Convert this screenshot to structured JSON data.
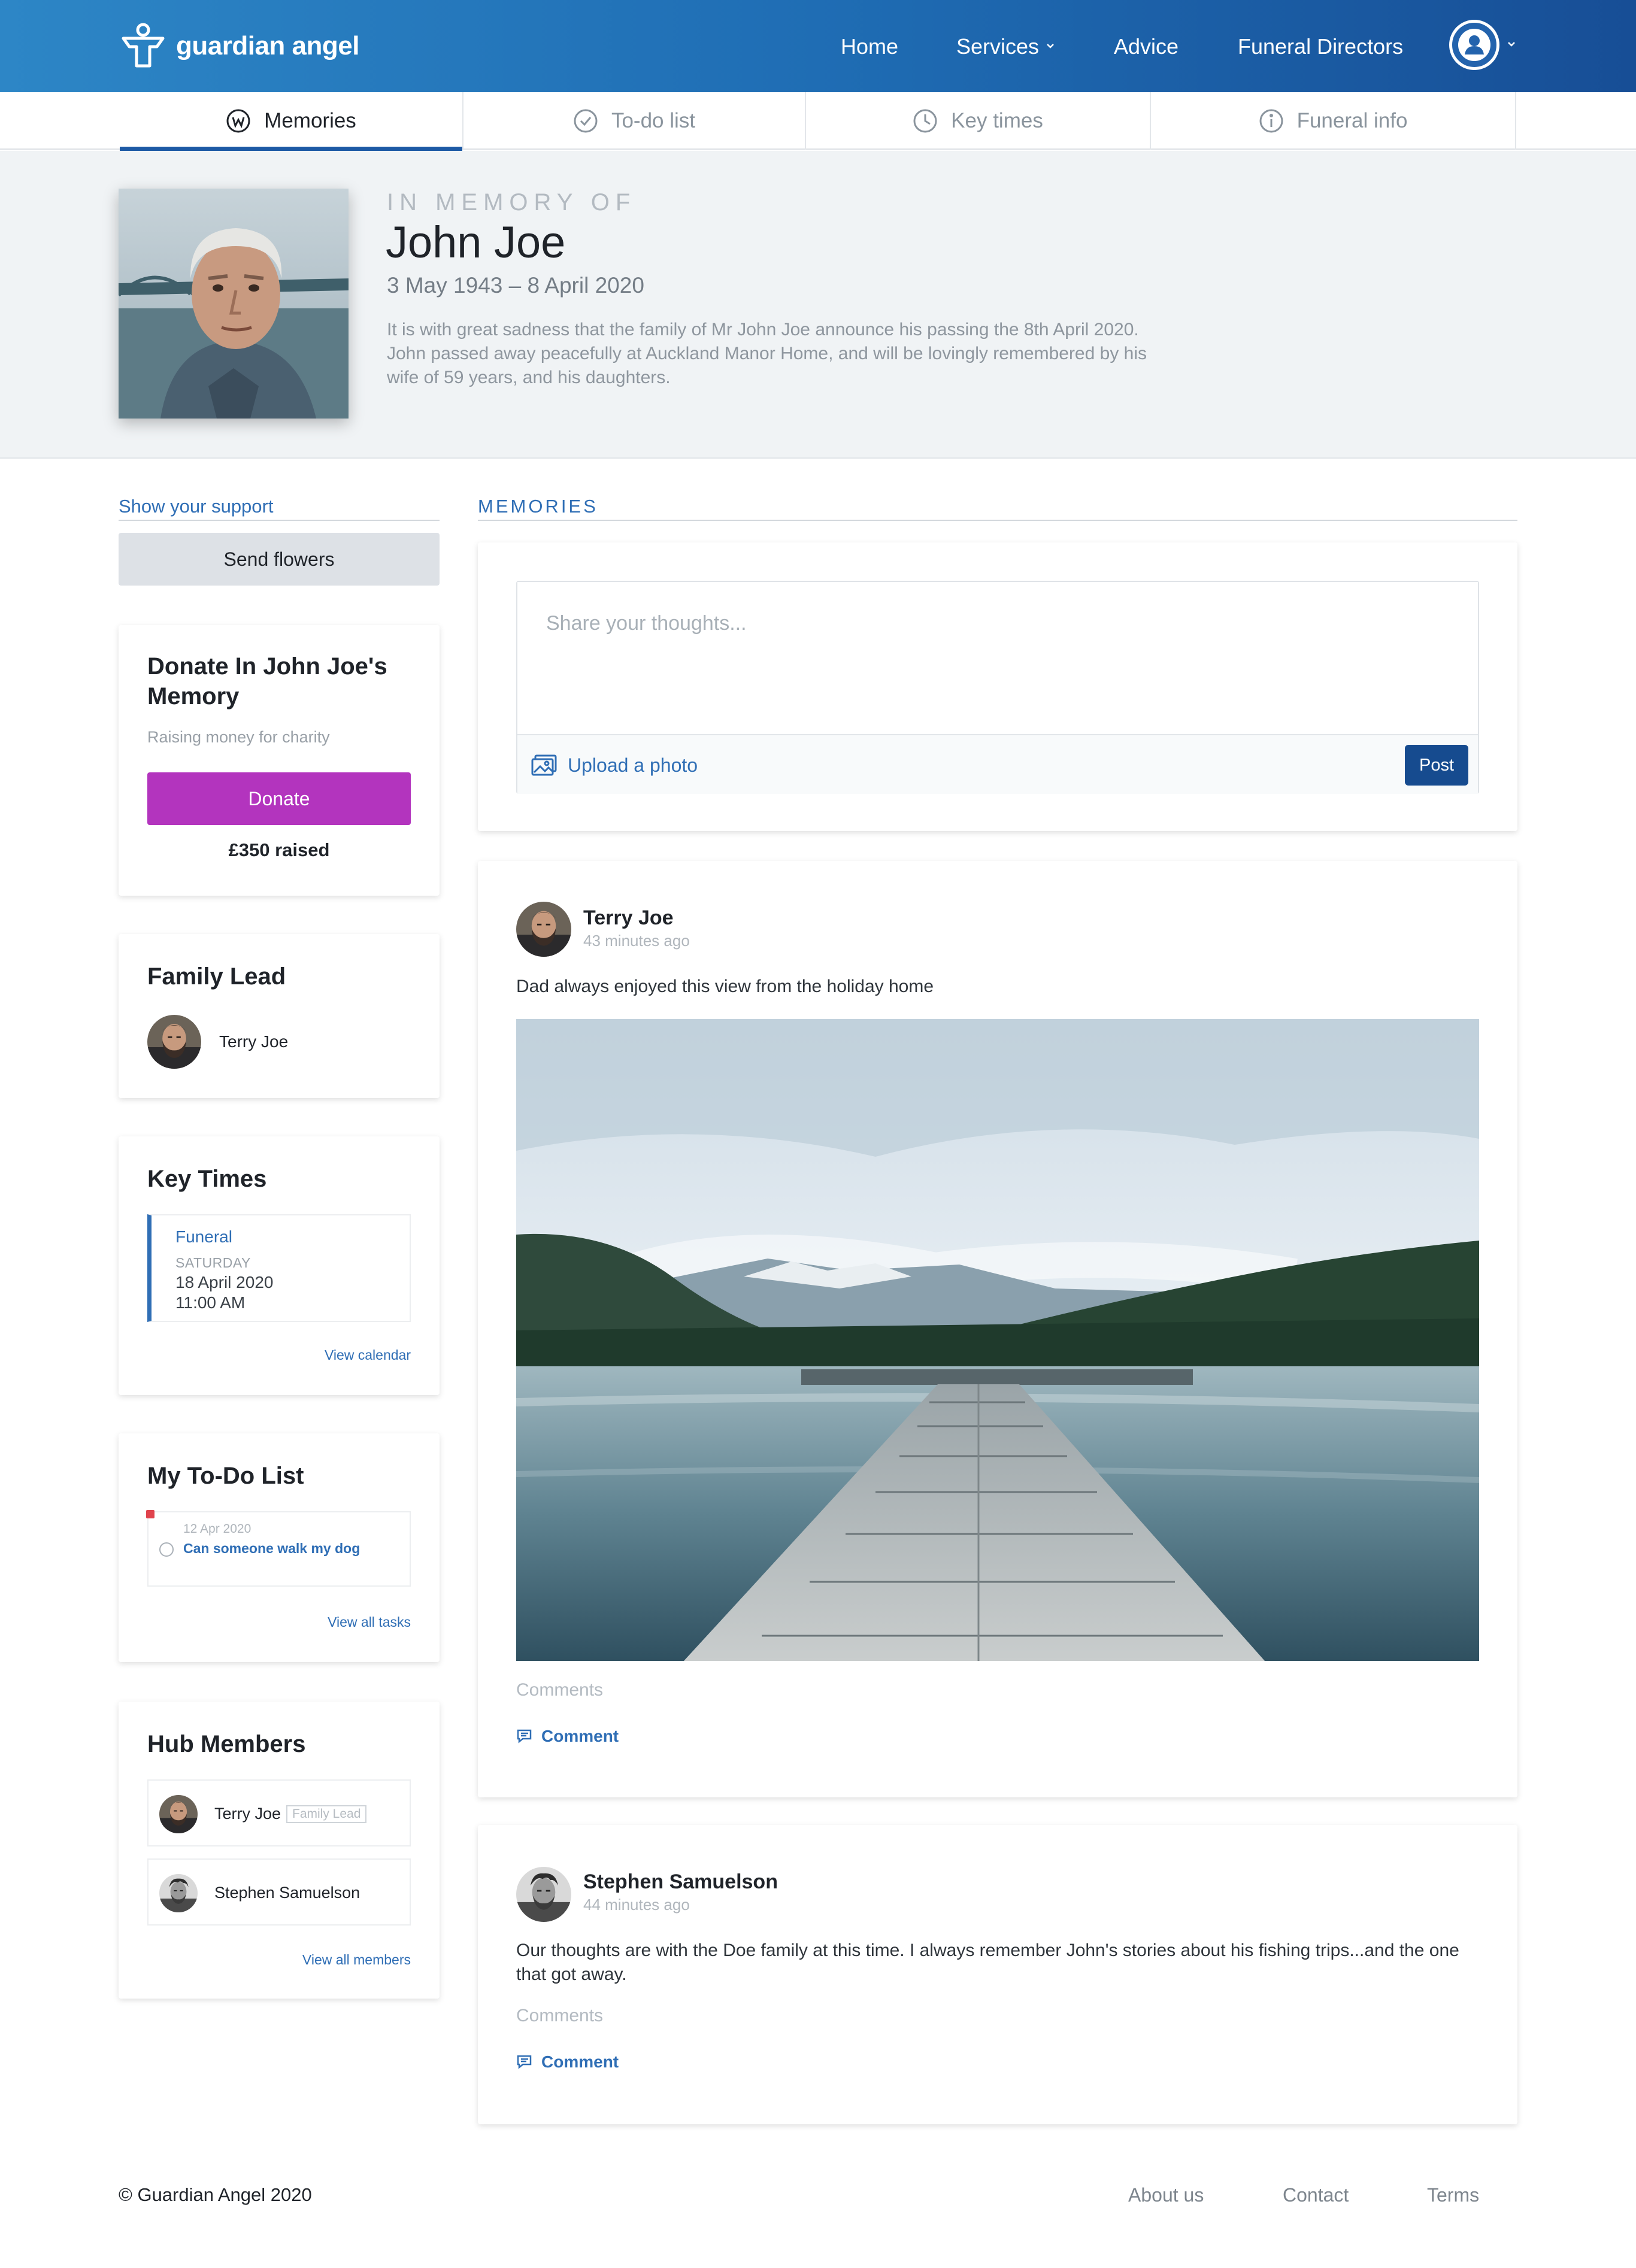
{
  "brand": {
    "name": "guardian angel",
    "accent": "#2f6eb5",
    "header_gradient": [
      "#2d86c6",
      "#174e96"
    ],
    "donate_color": "#b334be"
  },
  "nav": {
    "home": "Home",
    "services": "Services",
    "advice": "Advice",
    "funeral_directors": "Funeral Directors",
    "account_icon": "user-icon"
  },
  "tabs": [
    {
      "label": "Memories",
      "icon": "memories-icon",
      "active": true
    },
    {
      "label": "To-do list",
      "icon": "check-circle-icon",
      "active": false
    },
    {
      "label": "Key times",
      "icon": "clock-icon",
      "active": false
    },
    {
      "label": "Funeral info",
      "icon": "info-icon",
      "active": false
    }
  ],
  "hero": {
    "kicker": "IN MEMORY OF",
    "name": "John Joe",
    "dates": "3 May 1943 – 8 April 2020",
    "description": "It is with great sadness that the family of Mr John Joe announce his passing the 8th April 2020. John passed away peacefully at Auckland Manor Home, and will be lovingly remembered by his wife of 59 years, and his daughters."
  },
  "sidebar": {
    "support_label": "Show your support",
    "send_flowers": "Send flowers",
    "donate": {
      "title": "Donate In John Joe's Memory",
      "subtitle": "Raising money for charity",
      "button": "Donate",
      "raised": "£350 raised"
    },
    "family_lead": {
      "title": "Family Lead",
      "name": "Terry Joe"
    },
    "key_times": {
      "title": "Key Times",
      "event": "Funeral",
      "day": "SATURDAY",
      "date": "18 April 2020",
      "time": "11:00 AM",
      "link": "View calendar"
    },
    "todo": {
      "title": "My To-Do List",
      "items": [
        {
          "date": "12 Apr 2020",
          "text": "Can someone walk my dog",
          "done": false
        }
      ],
      "link": "View all tasks"
    },
    "members": {
      "title": "Hub Members",
      "items": [
        {
          "name": "Terry Joe",
          "badge": "Family Lead"
        },
        {
          "name": "Stephen Samuelson",
          "badge": ""
        }
      ],
      "link": "View all members"
    }
  },
  "main": {
    "section_label": "MEMORIES",
    "composer": {
      "placeholder": "Share your thoughts...",
      "upload": "Upload a photo",
      "post": "Post"
    },
    "posts": [
      {
        "author": "Terry Joe",
        "time": "43 minutes ago",
        "text": "Dad always enjoyed this view from the holiday home",
        "comments_label": "Comments",
        "comment_action": "Comment"
      },
      {
        "author": "Stephen Samuelson",
        "time": "44 minutes ago",
        "text": "Our thoughts are with the Doe family at this time. I always remember John's stories about his fishing trips...and the one that got away.",
        "comments_label": "Comments",
        "comment_action": "Comment"
      }
    ]
  },
  "footer": {
    "copyright": "© Guardian Angel 2020",
    "links": [
      "About us",
      "Contact",
      "Terms"
    ]
  }
}
